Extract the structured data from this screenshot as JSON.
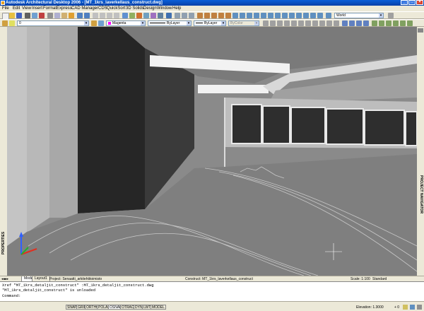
{
  "window": {
    "title": "Autodesk Architectural Desktop 2006 - [MT_1krs_laverkellaus_construct.dwg]"
  },
  "menu": [
    "File",
    "Edit",
    "View",
    "Insert",
    "Format",
    "Express",
    "CAD Manager",
    "CDS",
    "QuickSort",
    "3D Solids",
    "Design",
    "Window",
    "Help"
  ],
  "toolbar": {
    "layer_value": "0",
    "color_value": "Magenta",
    "linetype_value": "ByLayer",
    "lineweight_value": "ByLayer",
    "plotstyle_value": "ByColor",
    "ucs_value": "World"
  },
  "side": {
    "left_label": "PROPERTIES",
    "right_label": "PROJECT NAVIGATOR"
  },
  "drawing_bar": {
    "project": "Project: Senaatti_arkitehtitoimisto",
    "construct": "Construct: MT_1krs_laverkellaus_construct",
    "scale": "Scale: 1:100",
    "display": "Standard"
  },
  "tabs": [
    "Model",
    "Layout1"
  ],
  "command": {
    "line1": "Xref  \"MT_1krs_detaljit_construct\"  :MT_1krs_detaljit_construct.dwg",
    "line2": "\"MT_1krs_detaljit_construct\" is unloaded",
    "line3": "Command:"
  },
  "status": {
    "toggles": [
      "SNAP",
      "GRID",
      "ORTHO",
      "POLAR",
      "OSNAP",
      "OTRACK",
      "DYN",
      "LWT",
      "MODEL"
    ],
    "elevation": "Elevation: 1.3000",
    "extra": "+ 0"
  }
}
